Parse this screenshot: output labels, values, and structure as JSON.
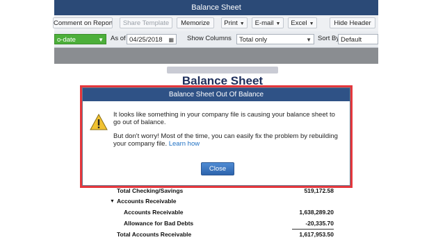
{
  "window": {
    "title": "Balance Sheet"
  },
  "toolbar": {
    "comment_label": "Comment on Report",
    "share_label": "Share Template",
    "memorize_label": "Memorize",
    "print_label": "Print",
    "email_label": "E-mail",
    "excel_label": "Excel",
    "hide_header_label": "Hide Header"
  },
  "filters": {
    "dates_value": "o-date",
    "as_of_label": "As of",
    "as_of_value": "04/25/2018",
    "show_columns_label": "Show Columns",
    "show_columns_value": "Total only",
    "sort_by_label": "Sort By",
    "sort_by_value": "Default"
  },
  "report": {
    "title": "Balance Sheet",
    "rows": [
      {
        "label": "Total Checking/Savings",
        "amount": "519,172.58"
      },
      {
        "label": "Accounts Receivable",
        "amount": ""
      },
      {
        "label": "Accounts Receivable",
        "amount": "1,638,289.20"
      },
      {
        "label": "Allowance for Bad Debts",
        "amount": "-20,335.70"
      },
      {
        "label": "Total Accounts Receivable",
        "amount": "1,617,953.50"
      }
    ]
  },
  "dialog": {
    "title": "Balance Sheet Out Of Balance",
    "message1": "It looks like something in your company file is causing your balance sheet to go out of balance.",
    "message2": "But don't worry! Most of the time, you can easily fix the problem by rebuilding your company file.",
    "learn_how": "Learn how",
    "close_label": "Close"
  },
  "colors": {
    "titlebar": "#2b4a77",
    "dialog_title": "#2f5286",
    "highlight_border": "#e4373c",
    "dates_green": "#4caf3a",
    "link": "#1d6fc3"
  }
}
